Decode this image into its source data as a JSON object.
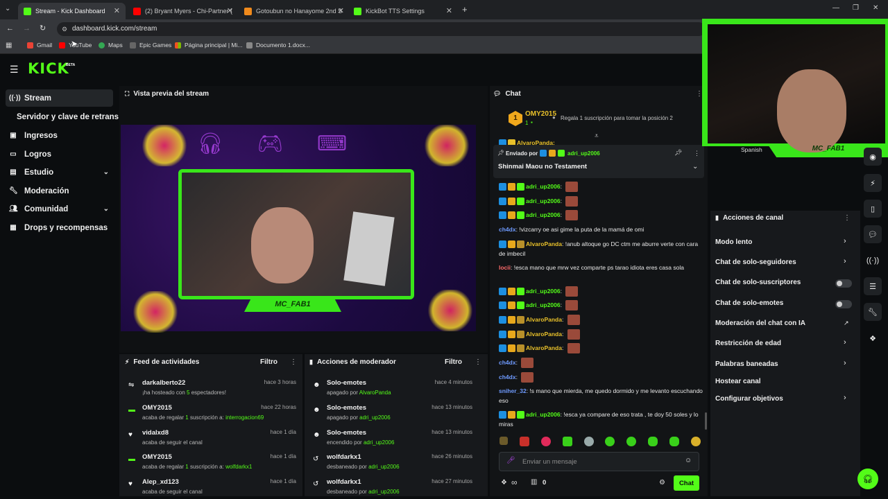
{
  "browser": {
    "tabs": [
      {
        "title": "Stream - Kick Dashboard",
        "color": "#53fc18"
      },
      {
        "title": "(2) Bryant Myers - Chi-Partner (",
        "color": "#ff0000"
      },
      {
        "title": "Gotoubun no Hanayome 2nd S",
        "color": "#f08a1c"
      },
      {
        "title": "KickBot TTS Settings",
        "color": "#53fc18"
      }
    ],
    "url": "dashboard.kick.com/stream",
    "bookmarks": [
      "Gmail",
      "YouTube",
      "Maps",
      "Epic Games",
      "Página principal | Mi...",
      "Documento 1.docx..."
    ]
  },
  "brand": {
    "logo": "KICK",
    "tag": "BETA"
  },
  "sidebar": [
    {
      "label": "Stream",
      "icon": "stream-icon"
    },
    {
      "label": "Servidor y clave de retransmisión",
      "icon": ""
    },
    {
      "label": "Ingresos",
      "icon": "income-icon"
    },
    {
      "label": "Logros",
      "icon": "achievements-icon"
    },
    {
      "label": "Estudio",
      "icon": "studio-icon"
    },
    {
      "label": "Moderación",
      "icon": "wrench-icon"
    },
    {
      "label": "Comunidad",
      "icon": "community-icon"
    },
    {
      "label": "Drops y recompensas",
      "icon": "gift-icon"
    }
  ],
  "preview": {
    "title": "Vista previa del stream",
    "overlay_name": "MC_FAB1"
  },
  "feed": {
    "title": "Feed de actividades",
    "filter": "Filtro",
    "items": [
      {
        "name": "darkalberto22",
        "time": "hace 3 horas",
        "text": "¡ha hosteado con ",
        "hl": "5",
        "rest": " espectadores!"
      },
      {
        "name": "OMY2015",
        "time": "hace 22 horas",
        "text": "acaba de regalar ",
        "hl": "1",
        "rest": " suscripción a: ",
        "hl2": "interrogacion69"
      },
      {
        "name": "vidalxd8",
        "time": "hace 1 día",
        "text": "acaba de seguir el canal",
        "hl": "",
        "rest": ""
      },
      {
        "name": "OMY2015",
        "time": "hace 1 día",
        "text": "acaba de regalar ",
        "hl": "1",
        "rest": " suscripción a: ",
        "hl2": "wolfdarkx1"
      },
      {
        "name": "Alep_xd123",
        "time": "hace 1 día",
        "text": "acaba de seguir el canal",
        "hl": "",
        "rest": ""
      }
    ]
  },
  "modactions": {
    "title": "Acciones de moderador",
    "filter": "Filtro",
    "items": [
      {
        "name": "Solo-emotes",
        "time": "hace 4 minutos",
        "text": "apagado por ",
        "by": "AlvaroPanda"
      },
      {
        "name": "Solo-emotes",
        "time": "hace 13 minutos",
        "text": "apagado por ",
        "by": "adri_up2006"
      },
      {
        "name": "Solo-emotes",
        "time": "hace 13 minutos",
        "text": "encendido por ",
        "by": "adri_up2006"
      },
      {
        "name": "wolfdarkx1",
        "time": "hace 26 minutos",
        "text": "desbaneado por ",
        "by": "adri_up2006"
      },
      {
        "name": "wolfdarkx1",
        "time": "hace 27 minutos",
        "text": "desbaneado por ",
        "by": "adri_up2006"
      }
    ]
  },
  "chat": {
    "title": "Chat",
    "leader": {
      "rank": "1",
      "name": "OMY2015",
      "count": "1",
      "gift_text": "Regala 1 suscripción para tomar la posición 2"
    },
    "pinned": {
      "by_label": "Enviado por",
      "by": "adri_up2006",
      "text": "Shinmai Maou no Testament",
      "partial": "AlvaroPanda:"
    },
    "messages": [
      {
        "user": "adri_up2006",
        "color": "#53fc18",
        "text": "",
        "emote": true
      },
      {
        "user": "adri_up2006",
        "color": "#53fc18",
        "text": "",
        "emote": true
      },
      {
        "user": "adri_up2006",
        "color": "#53fc18",
        "text": "",
        "emote": true
      },
      {
        "user": "ch4dx",
        "color": "#6f9bff",
        "text": "!vizcarry oe asi gime la puta de la mamá de omi",
        "emote": false
      },
      {
        "user": "AlvaroPanda",
        "color": "#e8c02a",
        "text": "!anub altoque go DC ctm me aburre verte con cara de imbecil",
        "emote": false
      },
      {
        "user": "locii",
        "color": "#ff6b6b",
        "text": "!esca mano que mrw vez comparte ps tarao idiota eres casa sola",
        "emote": false
      },
      {
        "user": "adri_up2006",
        "color": "#53fc18",
        "text": "",
        "emote": true
      },
      {
        "user": "adri_up2006",
        "color": "#53fc18",
        "text": "",
        "emote": true
      },
      {
        "user": "AlvaroPanda",
        "color": "#e8c02a",
        "text": "",
        "emote": true
      },
      {
        "user": "AlvaroPanda",
        "color": "#e8c02a",
        "text": "",
        "emote": true
      },
      {
        "user": "AlvaroPanda",
        "color": "#e8c02a",
        "text": "",
        "emote": true
      },
      {
        "user": "ch4dx",
        "color": "#6f9bff",
        "text": "",
        "emote": true
      },
      {
        "user": "ch4dx",
        "color": "#6f9bff",
        "text": "",
        "emote": true
      },
      {
        "user": "sniher_32",
        "color": "#6f9bff",
        "text": "!s mano que mierda, me quedo dormido y me levanto escuchando eso",
        "emote": false
      },
      {
        "user": "adri_up2006",
        "color": "#53fc18",
        "text": "!esca ya compare de eso trata , te doy 50 soles y lo miras",
        "emote": false
      }
    ],
    "input_placeholder": "Enviar un mensaje",
    "points": "0",
    "send_label": "Chat"
  },
  "webcam": {
    "name": "MC_FAB1",
    "overlay_text": "Spanish"
  },
  "channel_actions": {
    "title": "Acciones de canal",
    "items": [
      {
        "label": "Modo lento",
        "control": "arrow"
      },
      {
        "label": "Chat de solo-seguidores",
        "control": "arrow"
      },
      {
        "label": "Chat de solo-suscriptores",
        "control": "toggle"
      },
      {
        "label": "Chat de solo-emotes",
        "control": "toggle"
      },
      {
        "label": "Moderación del chat con IA",
        "control": "external"
      },
      {
        "label": "Restricción de edad",
        "control": "arrow"
      },
      {
        "label": "Palabras baneadas",
        "control": "arrow"
      },
      {
        "label": "Hostear canal",
        "control": "none"
      },
      {
        "label": "Configurar objetivos",
        "control": "arrow"
      }
    ]
  },
  "colors": {
    "accent": "#53fc18",
    "bg": "#0b0d0f",
    "panel": "#17191c"
  }
}
